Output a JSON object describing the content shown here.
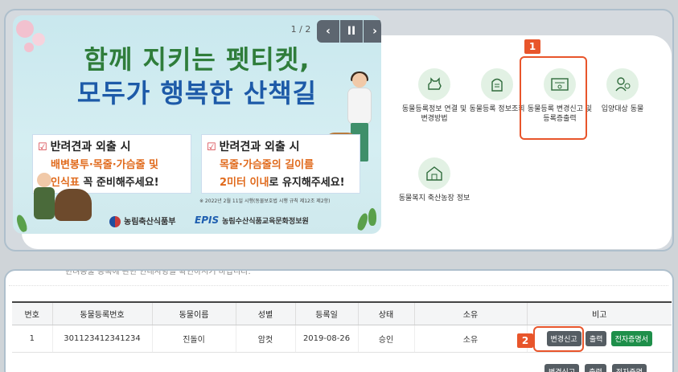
{
  "banner": {
    "title_line1": "함께 지키는 펫티켓,",
    "title_line2": "모두가 행복한 산책길",
    "counter": "1 / 2",
    "prev_symbol": "‹",
    "pause_symbol": "II",
    "next_symbol": "›",
    "note_left": {
      "head": "반려견과 외출 시",
      "line1": "배변봉투·목줄·가슴줄 및",
      "line2_highlight": "인식표",
      "line2_rest": " 꼭 준비해주세요!"
    },
    "note_right": {
      "head": "반려견과 외출 시",
      "line1": "목줄·가슴줄의 길이를",
      "line2_highlight": "2미터 이내",
      "line2_rest": "로 유지해주세요!"
    },
    "footnote": "※ 2022년 2월 11일 시행(동물보호법 시행 규칙 제12조 제2항)",
    "logo1": "농림축산식품부",
    "logo2_mark": "EPIS",
    "logo2": "농림수산식품교육문화정보원"
  },
  "icons": [
    {
      "icon": "dog-link-icon",
      "label": "동물등록정보 연결 및 변경방법"
    },
    {
      "icon": "tombstone-icon",
      "label": "동물등록 정보조회"
    },
    {
      "icon": "certificate-icon",
      "label": "동물등록 변경신고 및 등록증출력"
    },
    {
      "icon": "adoption-icon",
      "label": "입양대상 동물"
    },
    {
      "icon": "shelter-icon",
      "label": "동물복지 축산농장 정보"
    }
  ],
  "badges": {
    "one": "1",
    "two": "2"
  },
  "bottom": {
    "cut_text": "반려동물 등록에 관한 안내사항을 확인하시기 바랍니다."
  },
  "table": {
    "headers": [
      "번호",
      "동물등록번호",
      "동물이름",
      "성별",
      "등록일",
      "상태",
      "소유",
      "비고"
    ],
    "rows": [
      {
        "no": "1",
        "reg_no": "301123412341234",
        "name": "진돌이",
        "sex": "암컷",
        "date": "2019-08-26",
        "status": "승인",
        "own": "소유"
      }
    ],
    "buttons": {
      "change": "변경신고",
      "print": "출력",
      "cert": "전자증명서",
      "cert2": "전자증명"
    }
  },
  "colors": {
    "accent": "#e8552b",
    "green": "#1e8f4a",
    "icon_bg": "#e2f1e4"
  }
}
